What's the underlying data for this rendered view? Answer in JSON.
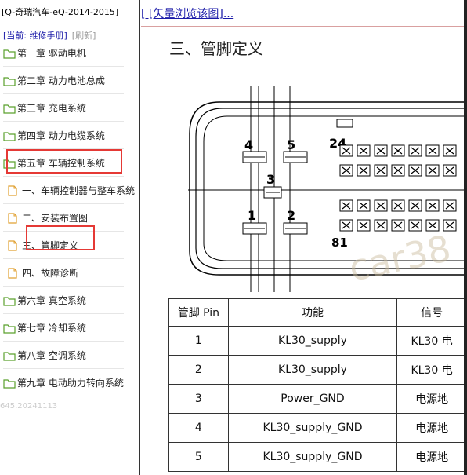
{
  "sidebar": {
    "header": "[Q-奇瑞汽车-eQ-2014-2015]",
    "current_label": "[当前: 维修手册]",
    "refresh_label": "[刷新]",
    "items": [
      {
        "label": "第一章 驱动电机"
      },
      {
        "label": "第二章 动力电池总成"
      },
      {
        "label": "第三章 充电系统"
      },
      {
        "label": "第四章 动力电缆系统"
      },
      {
        "label": "第五章 车辆控制系统"
      },
      {
        "label": "一、车辆控制器与整车系统"
      },
      {
        "label": "二、安装布置图"
      },
      {
        "label": "三、管脚定义"
      },
      {
        "label": "四、故障诊断"
      },
      {
        "label": "第六章 真空系统"
      },
      {
        "label": "第七章 冷却系统"
      },
      {
        "label": "第八章 空调系统"
      },
      {
        "label": "第九章 电动助力转向系统"
      }
    ],
    "version": "645.20241113"
  },
  "main": {
    "vector_link": "[ [矢量浏览该图]...",
    "section_title": "三、管脚定义",
    "diagram": {
      "pin_labels": [
        "4",
        "5",
        "24",
        "3",
        "1",
        "2",
        "81"
      ],
      "watermark": "car38"
    },
    "table": {
      "headers": [
        "管脚 Pin",
        "功能",
        "信号"
      ],
      "rows": [
        [
          "1",
          "KL30_supply",
          "KL30 电"
        ],
        [
          "2",
          "KL30_supply",
          "KL30 电"
        ],
        [
          "3",
          "Power_GND",
          "电源地"
        ],
        [
          "4",
          "KL30_supply_GND",
          "电源地"
        ],
        [
          "5",
          "KL30_supply_GND",
          "电源地"
        ]
      ]
    }
  },
  "colors": {
    "link": "#1a1aa8",
    "highlight": "#e53935",
    "folder": "#5aa02c",
    "doc": "#e0a030"
  }
}
